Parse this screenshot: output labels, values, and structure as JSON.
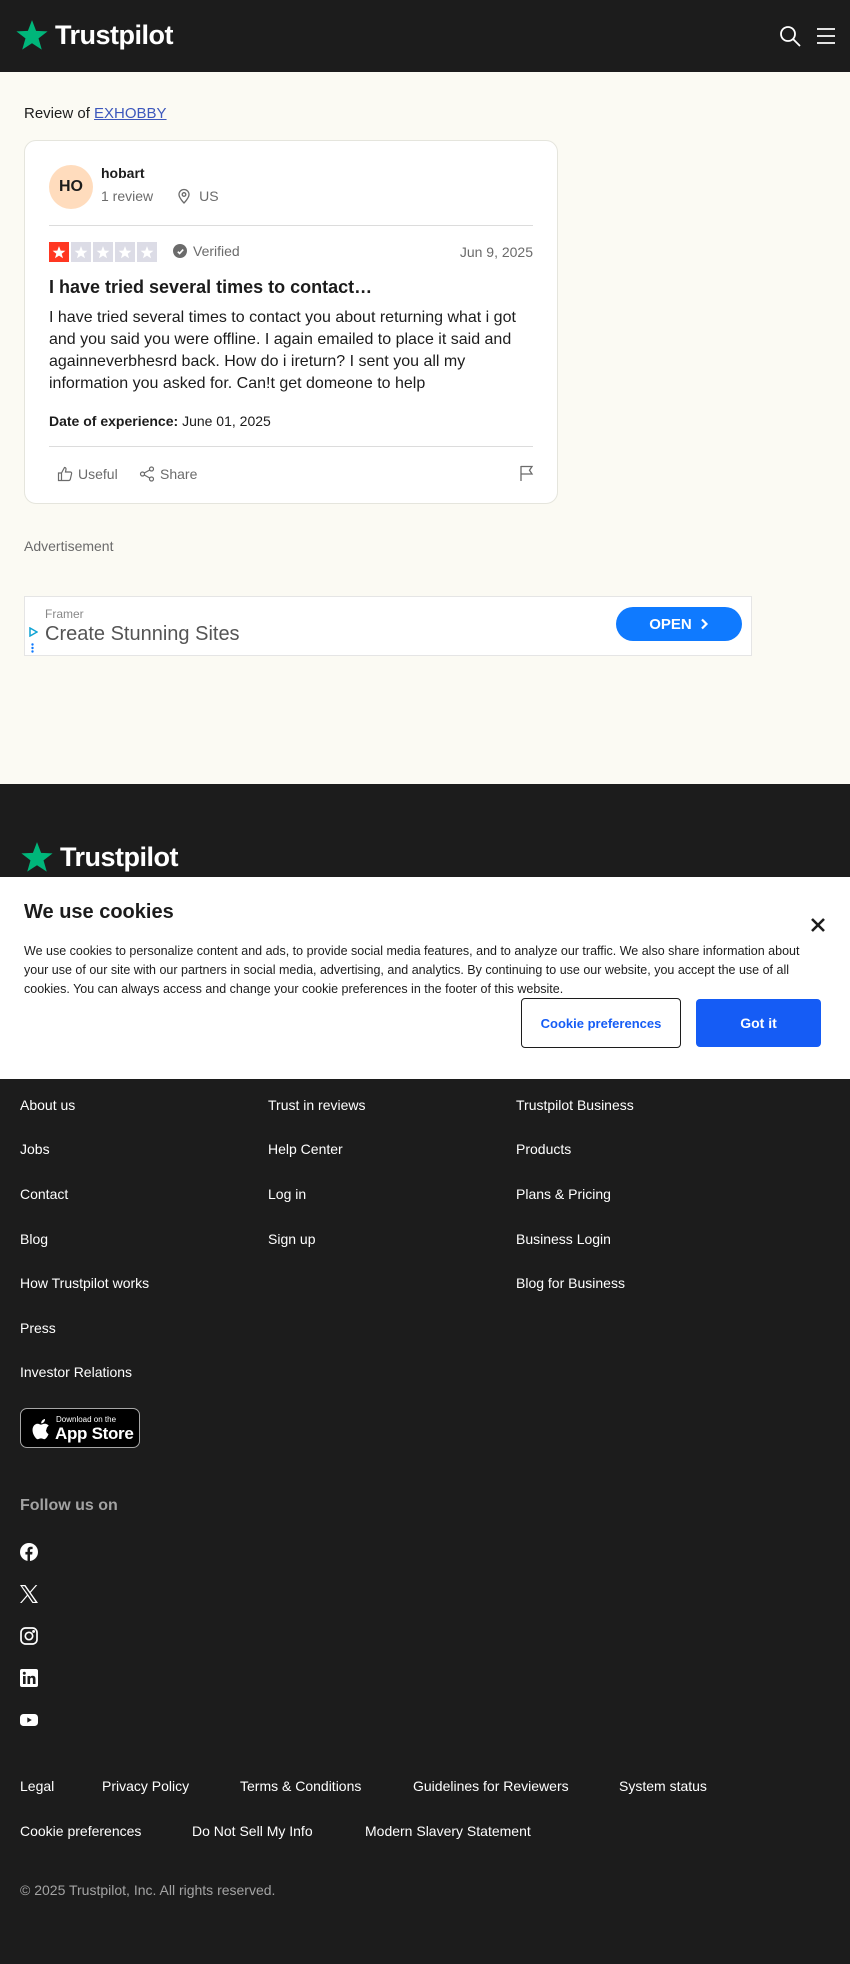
{
  "header": {
    "logo_text": "Trustpilot",
    "logo_icon": "star-icon",
    "search_icon": "search-icon",
    "menu_icon": "hamburger-menu-icon",
    "colors": {
      "background": "#1c1c1c",
      "brand": "#00b67a"
    }
  },
  "review_page": {
    "review_of_prefix": "Review of",
    "company_link": "EXHOBBY",
    "background": "#fbfaf3"
  },
  "review": {
    "avatar_initials": "HO",
    "username": "hobart",
    "review_count": "1 review",
    "country": "US",
    "rating": 1,
    "rating_max": 5,
    "verified_label": "Verified",
    "date": "Jun 9, 2025",
    "title": "I have tried several times to contact…",
    "body": "I have tried several times to contact you about returning what i got and you said you were offline. I again emailed to place it said and againneverbhesrd back. How do i ireturn? I sent you all my information you asked for. Can!t get domeone to help",
    "experience_label": "Date of experience:",
    "experience_date": "June 01, 2025",
    "useful_label": "Useful",
    "share_label": "Share",
    "colors": {
      "star_filled": "#ff3722",
      "star_empty": "#dcdce6"
    }
  },
  "advertisement": {
    "label": "Advertisement",
    "advertiser": "Framer",
    "headline": "Create Stunning Sites",
    "cta": "OPEN",
    "cta_color": "#0f7aff"
  },
  "footer": {
    "logo_text": "Trustpilot",
    "columns": [
      [
        "About us",
        "Jobs",
        "Contact",
        "Blog",
        "How Trustpilot works",
        "Press",
        "Investor Relations"
      ],
      [
        "Trust in reviews",
        "Help Center",
        "Log in",
        "Sign up"
      ],
      [
        "Trustpilot Business",
        "Products",
        "Plans & Pricing",
        "Business Login",
        "Blog for Business"
      ]
    ],
    "app_store_small": "Download on the",
    "app_store_big": "App Store",
    "follow_label": "Follow us on",
    "social_icons": [
      "facebook-icon",
      "x-icon",
      "instagram-icon",
      "linkedin-icon",
      "youtube-icon"
    ],
    "legal_links_row1": [
      "Legal",
      "Privacy Policy",
      "Terms & Conditions",
      "Guidelines for Reviewers",
      "System status"
    ],
    "legal_links_row2": [
      "Cookie preferences",
      "Do Not Sell My Info",
      "Modern Slavery Statement"
    ],
    "copyright": "© 2025 Trustpilot, Inc. All rights reserved."
  },
  "cookie_banner": {
    "title": "We use cookies",
    "text": "We use cookies to personalize content and ads, to provide social media features, and to analyze our traffic. We also share information about your use of our site with our partners in social media, advertising, and analytics. By continuing to use our website, you accept the use of all cookies. You can always access and change your cookie preferences in the footer of this website.",
    "preferences_button": "Cookie preferences",
    "accept_button": "Got it",
    "close_icon": "close-icon",
    "accent_color": "#155cf5"
  }
}
